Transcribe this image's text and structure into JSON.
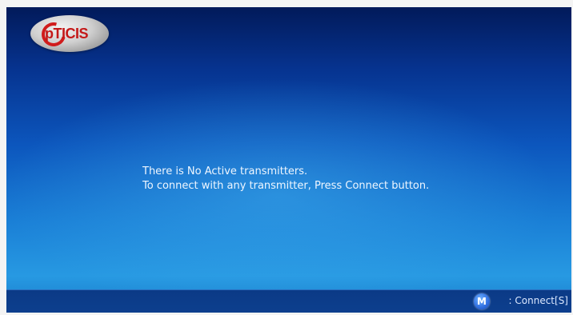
{
  "logo": {
    "text": "pTICIS",
    "brand_color": "#c41818"
  },
  "message": {
    "line1": "There is No Active transmitters.",
    "line2": "To connect with any transmitter, Press Connect button."
  },
  "status_bar": {
    "button_glyph": "M",
    "connect_label": ": Connect[S]"
  },
  "colors": {
    "background_top": "#021a5a",
    "background_bottom": "#2799e2",
    "status_bar": "#0d3f8e",
    "text": "#eef6ff"
  }
}
